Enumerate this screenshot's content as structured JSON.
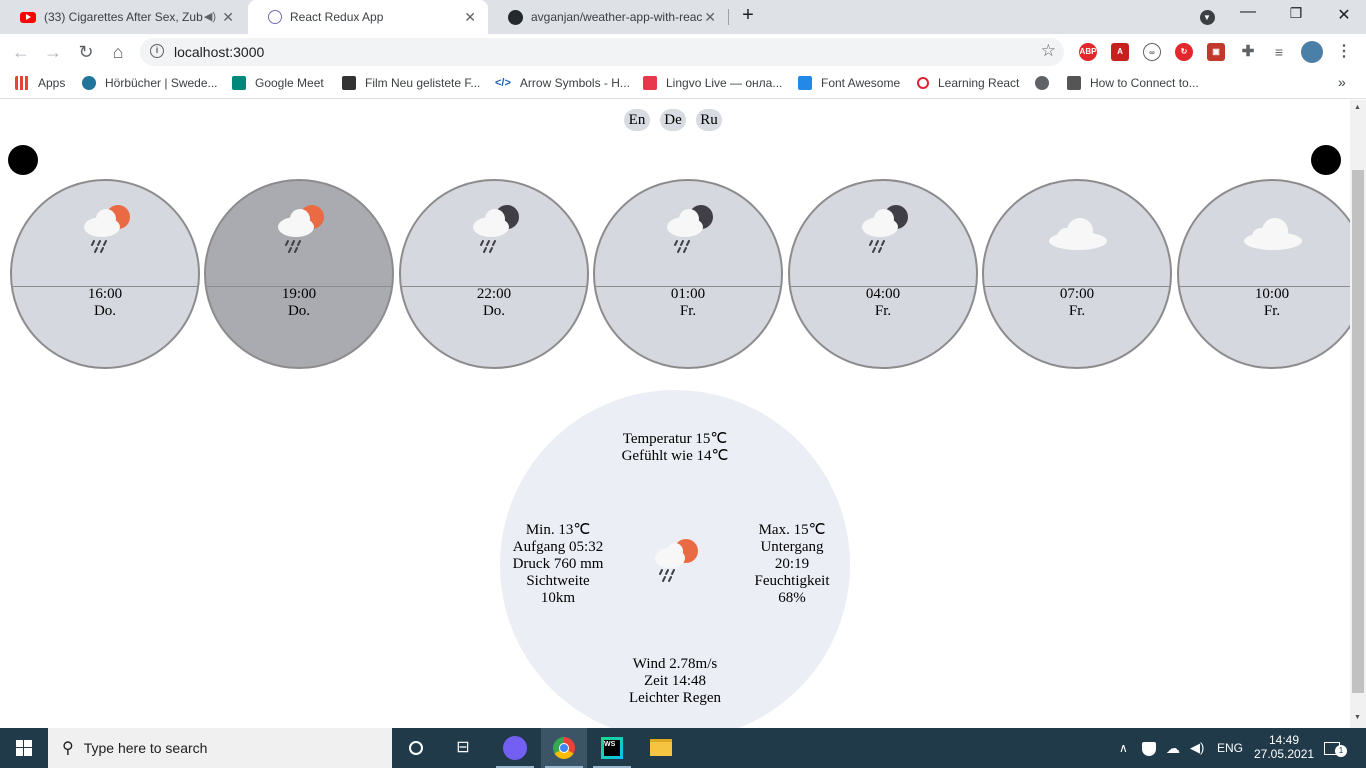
{
  "browser": {
    "tabs": [
      {
        "title": "(33) Cigarettes After Sex, Zub",
        "active": false
      },
      {
        "title": "React Redux App",
        "active": true
      },
      {
        "title": "avganjan/weather-app-with-reac",
        "active": false
      }
    ],
    "new_tab": "+",
    "url": "localhost:3000",
    "bookmarks": [
      {
        "label": "Apps"
      },
      {
        "label": "Hörbücher | Swede..."
      },
      {
        "label": "Google Meet"
      },
      {
        "label": "Film Neu gelistete F..."
      },
      {
        "label": "Arrow Symbols - H..."
      },
      {
        "label": "Lingvo Live — онла..."
      },
      {
        "label": "Font Awesome"
      },
      {
        "label": "Learning React"
      },
      {
        "label": ""
      },
      {
        "label": "How to Connect to..."
      }
    ],
    "more": "»"
  },
  "weather": {
    "languages": [
      "En",
      "De",
      "Ru"
    ],
    "forecast": [
      {
        "time": "16:00",
        "day": "Do.",
        "icon": "rain-sun-icon",
        "selected": false
      },
      {
        "time": "19:00",
        "day": "Do.",
        "icon": "rain-sun-icon",
        "selected": true
      },
      {
        "time": "22:00",
        "day": "Do.",
        "icon": "rain-moon-icon",
        "selected": false
      },
      {
        "time": "01:00",
        "day": "Fr.",
        "icon": "rain-moon-icon",
        "selected": false
      },
      {
        "time": "04:00",
        "day": "Fr.",
        "icon": "rain-moon-icon",
        "selected": false
      },
      {
        "time": "07:00",
        "day": "Fr.",
        "icon": "cloud-icon",
        "selected": false
      },
      {
        "time": "10:00",
        "day": "Fr.",
        "icon": "cloud-icon",
        "selected": false
      }
    ],
    "detail": {
      "temperature": "Temperatur 15℃",
      "feels_like": "Gefühlt wie 14℃",
      "min": "Min. 13℃",
      "sunrise": "Aufgang 05:32",
      "pressure": "Druck 760 mm",
      "visibility_label": "Sichtweite",
      "visibility_value": "10km",
      "max": "Max. 15℃",
      "sunset_label": "Untergang",
      "sunset_value": "20:19",
      "humidity_label": "Feuchtigkeit",
      "humidity_value": "68%",
      "wind": "Wind 2.78m/s",
      "time": "Zeit 14:48",
      "description": "Leichter Regen"
    }
  },
  "taskbar": {
    "search_placeholder": "Type here to search",
    "language": "ENG",
    "clock_time": "14:49",
    "clock_date": "27.05.2021",
    "notifications": "1"
  },
  "colors": {
    "card_bg": "#d6d8e0",
    "card_selected_bg": "#a9abb0",
    "detail_bg": "#eceef5",
    "sun": "#ea6b43",
    "moon": "#3f3f45",
    "cloud": "#f7f7f7",
    "taskbar": "#203a4a"
  }
}
